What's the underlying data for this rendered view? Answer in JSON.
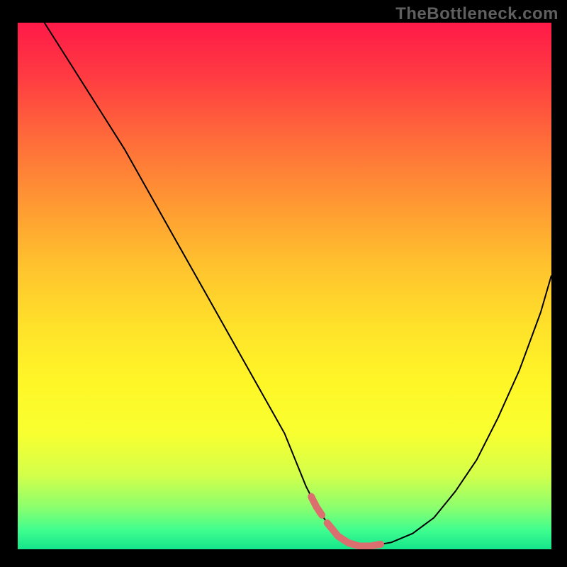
{
  "watermark": "TheBottleneck.com",
  "colors": {
    "page_bg": "#000000",
    "curve": "#000000",
    "pink_segment": "#db6e6e",
    "watermark": "#5f5f5f"
  },
  "gradient_stops": [
    {
      "offset": 0.0,
      "color": "#ff1a48"
    },
    {
      "offset": 0.1,
      "color": "#ff3a42"
    },
    {
      "offset": 0.22,
      "color": "#ff6b3a"
    },
    {
      "offset": 0.34,
      "color": "#ff9733"
    },
    {
      "offset": 0.46,
      "color": "#ffc22e"
    },
    {
      "offset": 0.58,
      "color": "#ffe22a"
    },
    {
      "offset": 0.68,
      "color": "#fff627"
    },
    {
      "offset": 0.78,
      "color": "#f8ff30"
    },
    {
      "offset": 0.86,
      "color": "#d3ff4a"
    },
    {
      "offset": 0.92,
      "color": "#8cff6e"
    },
    {
      "offset": 0.965,
      "color": "#3dfd8f"
    },
    {
      "offset": 1.0,
      "color": "#16e58b"
    }
  ],
  "chart_data": {
    "type": "line",
    "title": "",
    "xlabel": "",
    "ylabel": "",
    "xlim": [
      0,
      100
    ],
    "ylim": [
      0,
      100
    ],
    "grid": false,
    "legend": false,
    "series": [
      {
        "name": "bottleneck-curve",
        "x": [
          5,
          10,
          15,
          20,
          25,
          30,
          35,
          40,
          45,
          50,
          52,
          54,
          56,
          58,
          60,
          62,
          64,
          66,
          70,
          74,
          78,
          82,
          86,
          90,
          94,
          98,
          100
        ],
        "y": [
          100,
          92,
          84,
          76,
          67,
          58,
          49,
          40,
          31,
          22,
          17,
          12,
          8,
          5,
          2.5,
          1.2,
          0.6,
          0.6,
          1.3,
          3.0,
          6.0,
          11,
          17,
          25,
          34,
          45,
          52
        ]
      }
    ],
    "highlight_range_x": [
      55,
      68
    ],
    "highlight_segments_approx_x": [
      [
        55,
        57
      ],
      [
        58,
        66
      ],
      [
        66.5,
        68
      ]
    ],
    "notes": "V-shaped curve over a vertical red→yellow→green gradient; pink dashed overlay near valley minimum. Values estimated from pixels; no axis ticks/labels visible."
  }
}
